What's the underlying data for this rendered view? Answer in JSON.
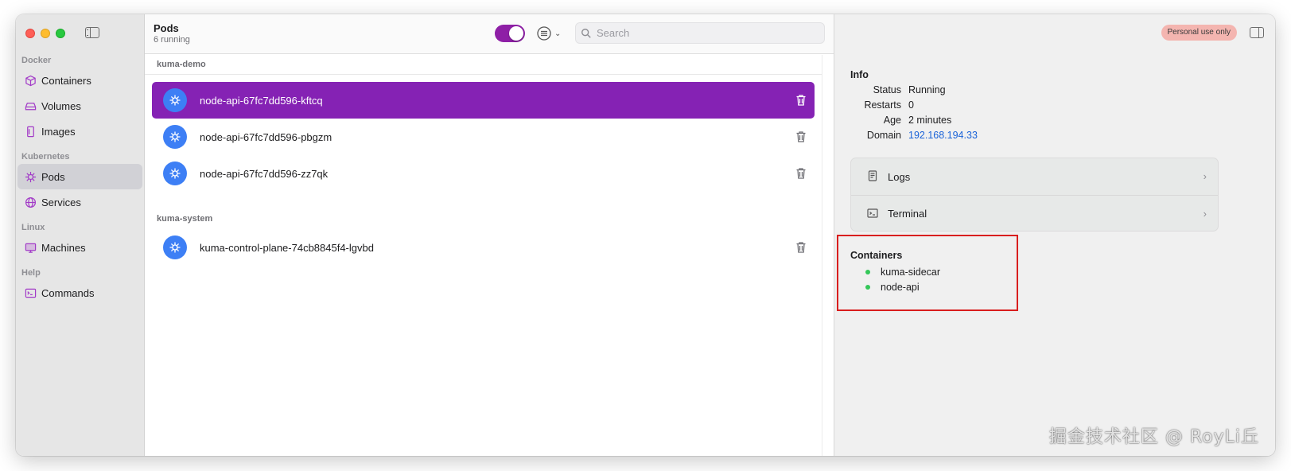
{
  "sidebar": {
    "sections": [
      {
        "label": "Docker",
        "items": [
          {
            "label": "Containers",
            "icon": "cube-icon"
          },
          {
            "label": "Volumes",
            "icon": "drive-icon"
          },
          {
            "label": "Images",
            "icon": "image-stack-icon"
          }
        ]
      },
      {
        "label": "Kubernetes",
        "items": [
          {
            "label": "Pods",
            "icon": "helm-icon",
            "active": true
          },
          {
            "label": "Services",
            "icon": "globe-icon"
          }
        ]
      },
      {
        "label": "Linux",
        "items": [
          {
            "label": "Machines",
            "icon": "monitor-icon"
          }
        ]
      },
      {
        "label": "Help",
        "items": [
          {
            "label": "Commands",
            "icon": "terminal-icon"
          }
        ]
      }
    ]
  },
  "toolbar": {
    "title": "Pods",
    "subtitle": "6 running",
    "toggle_on": true,
    "search_placeholder": "Search",
    "search_value": ""
  },
  "namespaces": [
    {
      "name": "kuma-demo",
      "pods": [
        {
          "name": "node-api-67fc7dd596-kftcq",
          "selected": true
        },
        {
          "name": "node-api-67fc7dd596-pbgzm",
          "selected": false
        },
        {
          "name": "node-api-67fc7dd596-zz7qk",
          "selected": false
        }
      ]
    },
    {
      "name": "kuma-system",
      "pods": [
        {
          "name": "kuma-control-plane-74cb8845f4-lgvbd",
          "selected": false
        }
      ]
    }
  ],
  "detail": {
    "badge": "Personal use only",
    "info_title": "Info",
    "info": [
      {
        "key": "Status",
        "value": "Running"
      },
      {
        "key": "Restarts",
        "value": "0"
      },
      {
        "key": "Age",
        "value": "2 minutes"
      },
      {
        "key": "Domain",
        "value": "192.168.194.33"
      }
    ],
    "actions": [
      {
        "label": "Logs",
        "icon": "document-icon"
      },
      {
        "label": "Terminal",
        "icon": "terminal-icon"
      }
    ],
    "containers_title": "Containers",
    "containers": [
      "kuma-sidecar",
      "node-api"
    ]
  },
  "watermark": "掘金技术社区 @ RoyLi丘",
  "colors": {
    "accent": "#8522b4",
    "pod_icon": "#3d7ff5",
    "link": "#1a63d8",
    "highlight_box": "#d91e1e",
    "status_dot": "#34c759"
  }
}
